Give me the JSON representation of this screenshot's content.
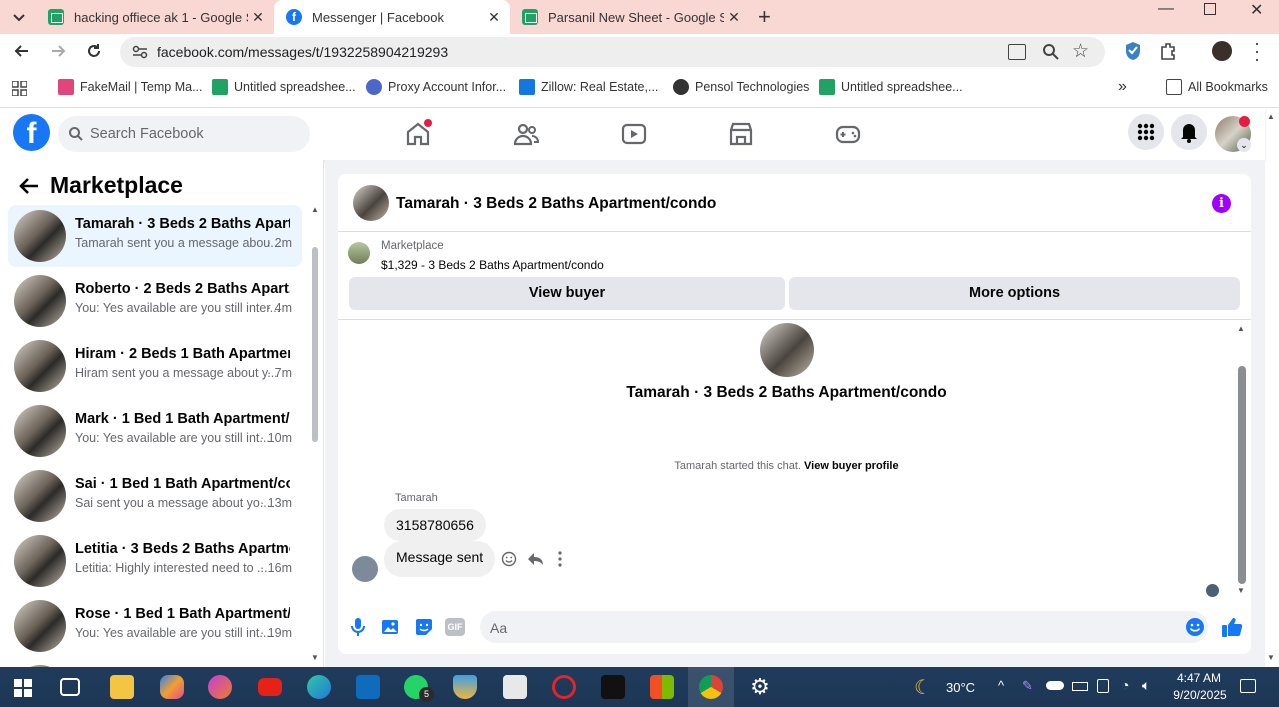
{
  "browser": {
    "tabs": [
      {
        "title": "hacking offiece ak 1 - Google S",
        "icon": "sheets-icon",
        "active": false
      },
      {
        "title": "Messenger | Facebook",
        "icon": "facebook-icon",
        "active": true
      },
      {
        "title": "Parsanil New Sheet - Google Sh",
        "icon": "sheets-icon",
        "active": false
      }
    ],
    "url": "facebook.com/messages/t/1932258904219293",
    "bookmarks": [
      {
        "label": "FakeMail | Temp Ma...",
        "color": "#e0457b"
      },
      {
        "label": "Untitled spreadshee...",
        "color": "#1ea362"
      },
      {
        "label": "Proxy Account Infor...",
        "color": "#4a67c9"
      },
      {
        "label": "Zillow: Real Estate,...",
        "color": "#1277e1"
      },
      {
        "label": "Pensol Technologies",
        "color": "#333333"
      },
      {
        "label": "Untitled spreadshee...",
        "color": "#1ea362"
      }
    ],
    "all_bookmarks": "All Bookmarks"
  },
  "fb_header": {
    "search_placeholder": "Search Facebook",
    "logo": "f"
  },
  "sidebar": {
    "title": "Marketplace",
    "conversations": [
      {
        "name": "Tamarah · 3 Beds 2 Baths Apart...",
        "preview": "Tamarah sent you a message abou...",
        "time": "· 2m",
        "selected": true
      },
      {
        "name": "Roberto · 2 Beds 2 Baths Apart...",
        "preview": "You: Yes available are you still inter...",
        "time": "· 4m",
        "selected": false
      },
      {
        "name": "Hiram · 2 Beds 1 Bath Apartmen...",
        "preview": "Hiram sent you a message about y...",
        "time": "· 7m",
        "selected": false
      },
      {
        "name": "Mark · 1 Bed 1 Bath Apartment/...",
        "preview": "You: Yes available are you still int...",
        "time": "· 10m",
        "selected": false
      },
      {
        "name": "Sai · 1 Bed 1 Bath Apartment/co...",
        "preview": "Sai sent you a message about yo...",
        "time": "· 13m",
        "selected": false
      },
      {
        "name": "Letitia · 3 Beds 2 Baths Apartme...",
        "preview": "Letitia: Highly interested need to ...",
        "time": "· 16m",
        "selected": false
      },
      {
        "name": "Rose · 1 Bed 1 Bath Apartment/c...",
        "preview": "You: Yes available are you still int...",
        "time": "· 19m",
        "selected": false
      }
    ]
  },
  "chat": {
    "title": "Tamarah · 3 Beds 2 Baths Apartment/condo",
    "marketplace_label": "Marketplace",
    "listing": "$1,329 - 3 Beds 2 Baths Apartment/condo",
    "view_buyer": "View buyer",
    "more_options": "More options",
    "profile_name": "Tamarah · 3 Beds 2 Baths Apartment/condo",
    "started_text": "Tamarah started this chat.",
    "view_profile": "View buyer profile",
    "sender": "Tamarah",
    "messages": [
      "3158780656",
      "Message sent"
    ],
    "input_placeholder": "Aa"
  },
  "taskbar": {
    "weather": "30°C",
    "time": "4:47 AM",
    "date": "9/20/2025",
    "whatsapp_badge": "5"
  }
}
